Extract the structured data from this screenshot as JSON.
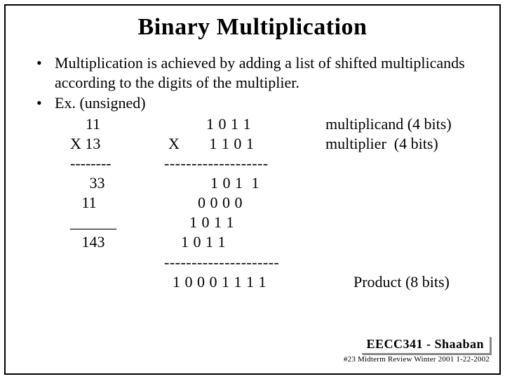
{
  "title": "Binary Multiplication",
  "bullet1": "Multiplication is achieved by adding a list of shifted multiplicands according to the digits of the multiplier.",
  "bullet2": "Ex.   (unsigned)",
  "dec": {
    "r1": "    11",
    "r2": "X 13",
    "r3": "--------",
    "r4": "     33",
    "r5": "   11",
    "r6": "______",
    "r7": "   143"
  },
  "bin": {
    "r1": "          1 0 1 1",
    "r2": " X       1 1 0 1",
    "r3": "-------------------",
    "r4": "           1 0 1  1",
    "r5": "        0 0 0 0",
    "r6": "      1 0 1 1",
    "r7": "    1 0 1 1",
    "r8": "---------------------",
    "r9": "  1 0 0 0 1 1 1 1"
  },
  "label": {
    "multiplicand": "multiplicand (4 bits)",
    "multiplier": "multiplier  (4 bits)",
    "product": "Product (8 bits)"
  },
  "footer": {
    "main": "EECC341 - Shaaban",
    "sub": "#23   Midterm Review   Winter 2001  1-22-2002"
  }
}
